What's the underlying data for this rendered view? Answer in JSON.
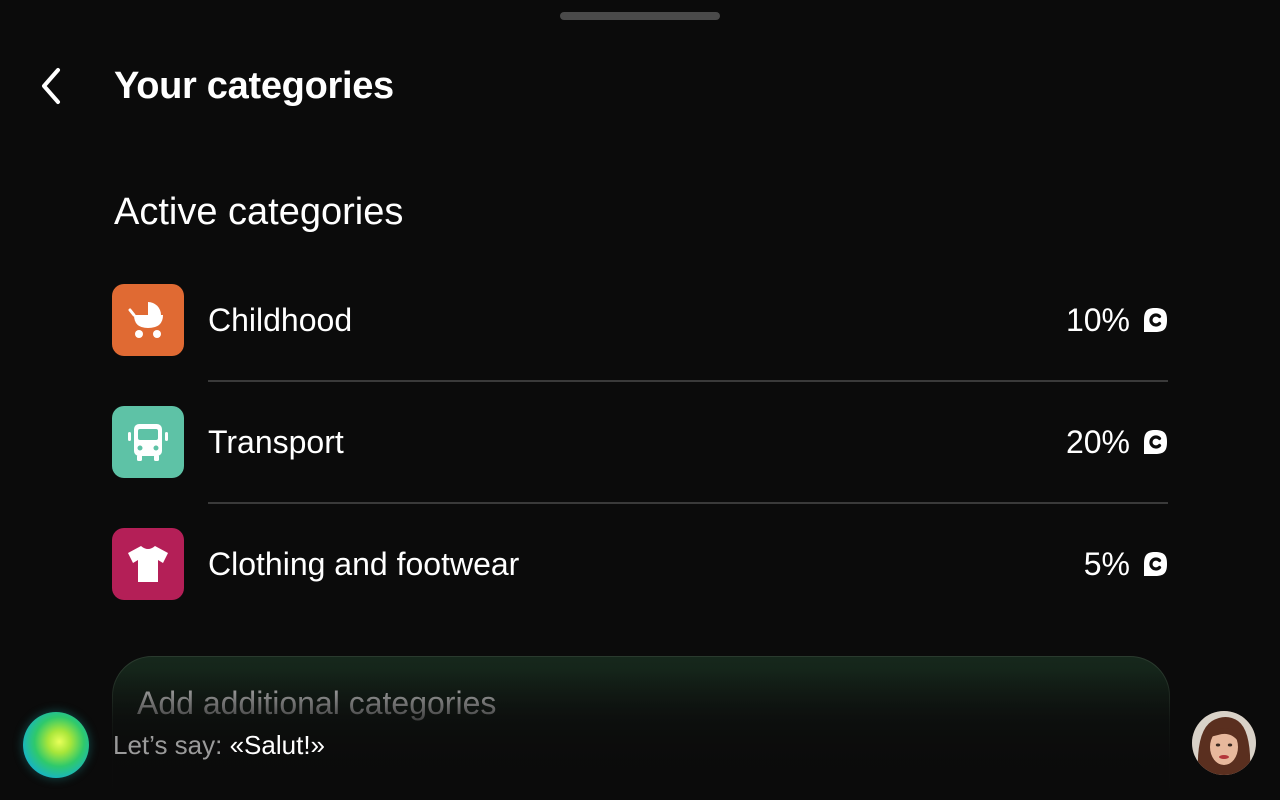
{
  "header": {
    "title": "Your categories",
    "back_icon": "chevron-left-icon"
  },
  "section": {
    "title": "Active categories"
  },
  "categories": [
    {
      "label": "Childhood",
      "value": "10%",
      "icon": "baby-stroller-icon",
      "color": "#e06a33"
    },
    {
      "label": "Transport",
      "value": "20%",
      "icon": "bus-icon",
      "color": "#5ec2a6"
    },
    {
      "label": "Clothing and footwear",
      "value": "5%",
      "icon": "tshirt-icon",
      "color": "#b41f57"
    }
  ],
  "add_card": {
    "title": "Add additional categories"
  },
  "assistant": {
    "hint_prefix": "Let’s say:",
    "hint_phrase": "«Salut!»"
  },
  "colors": {
    "background": "#0b0b0b",
    "divider": "#3a3a3a",
    "accent_green": "#16281c"
  }
}
